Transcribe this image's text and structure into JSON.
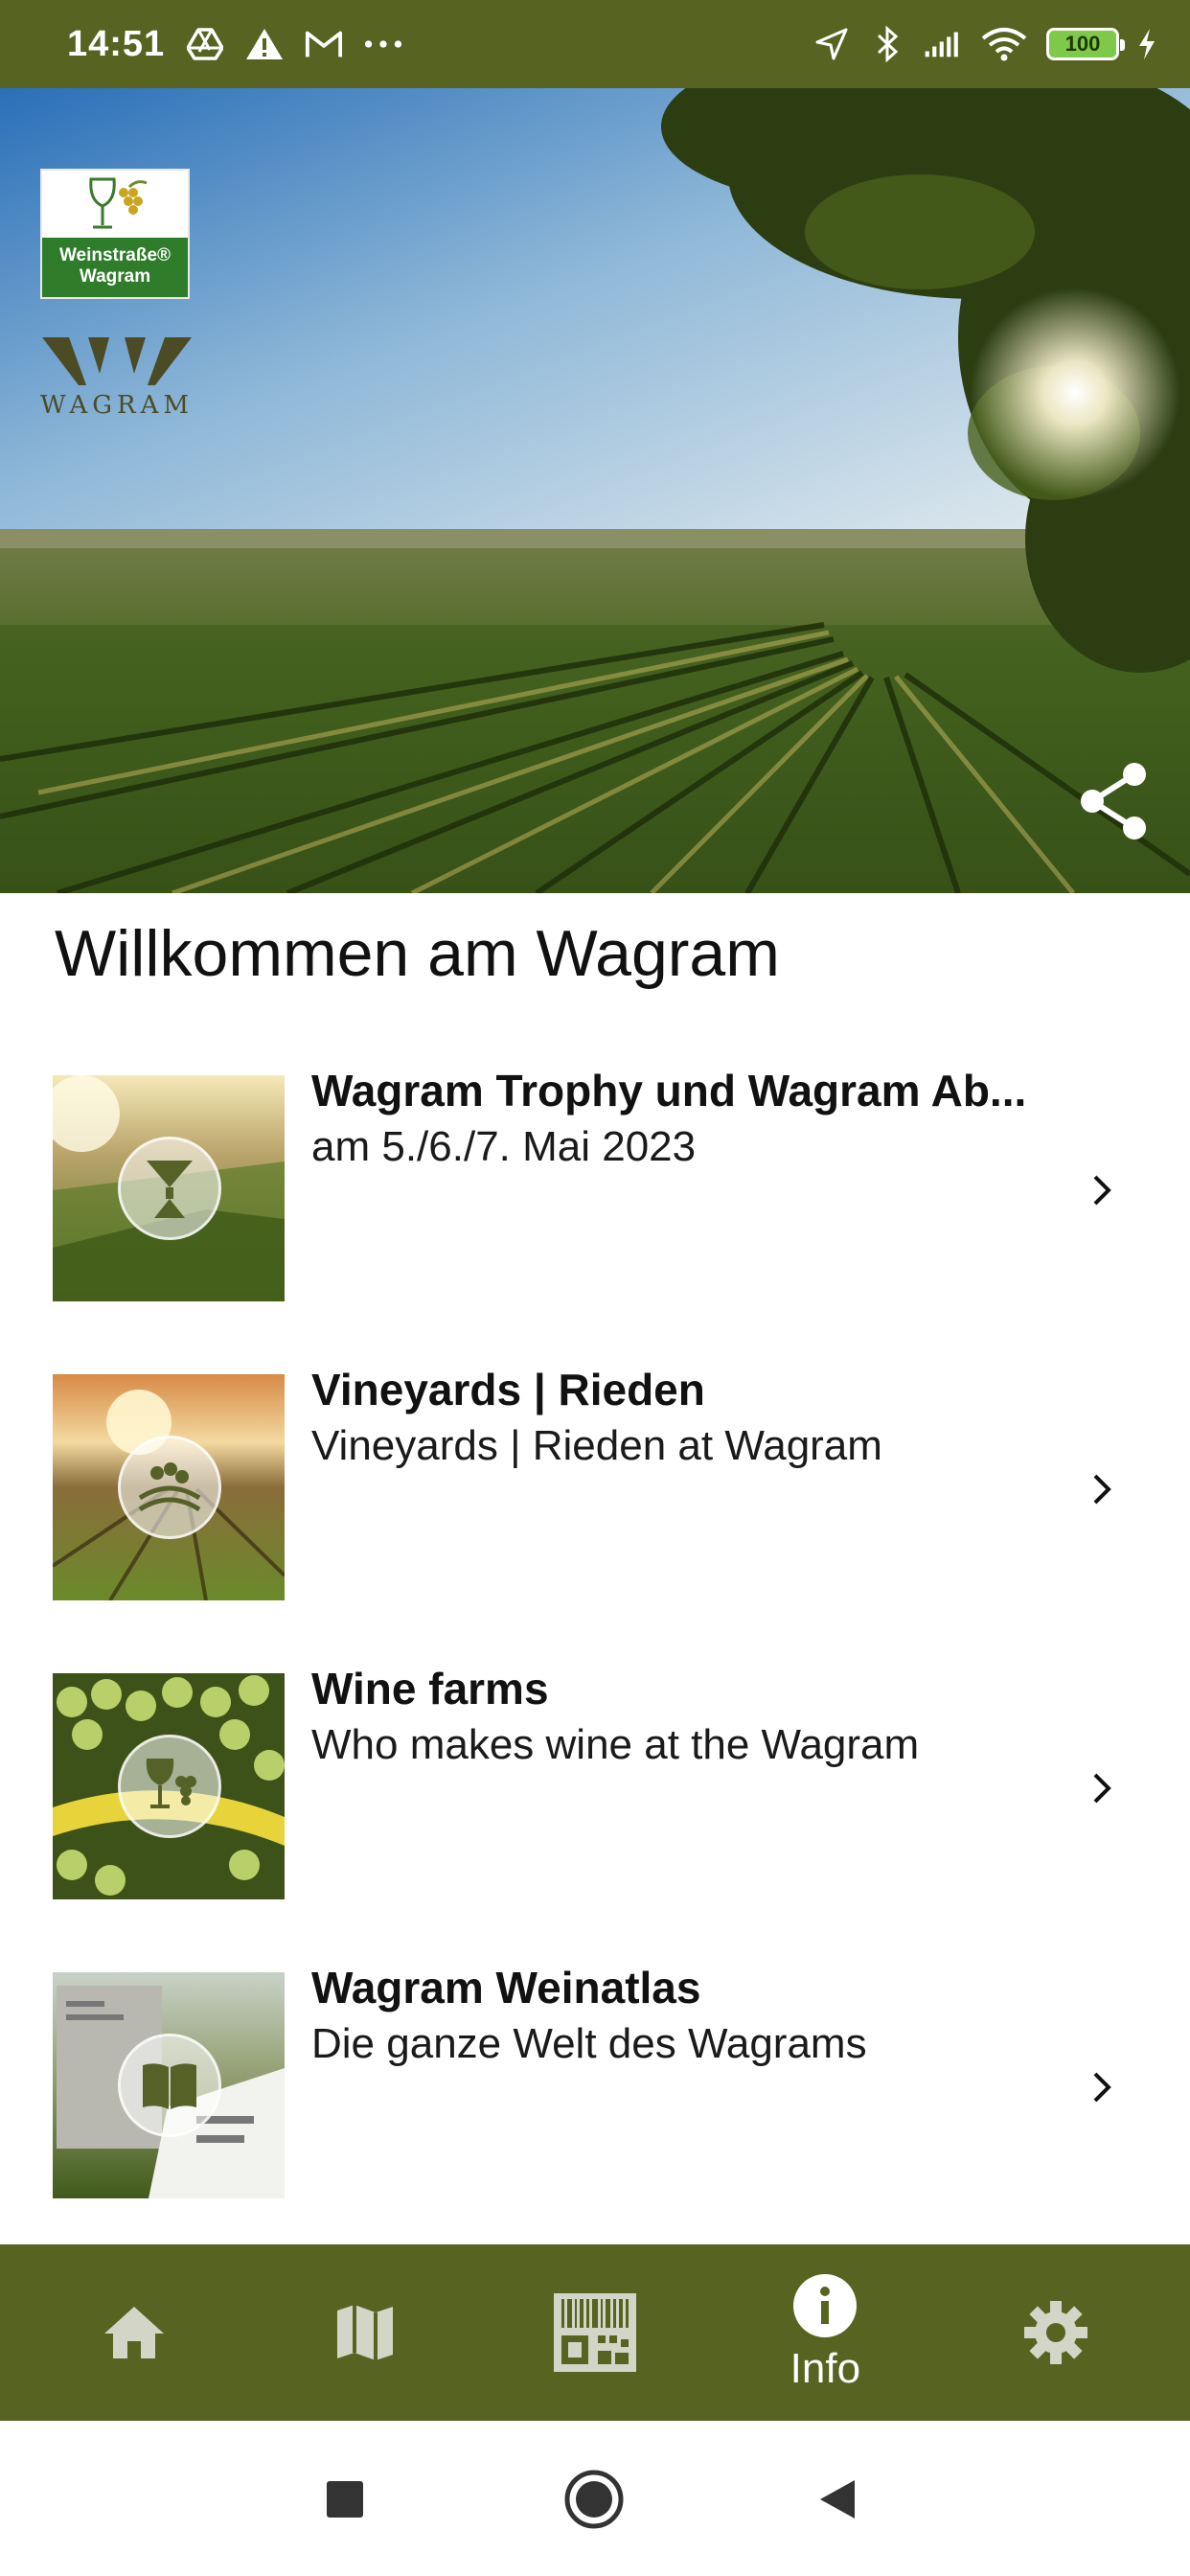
{
  "status_bar": {
    "time": "14:51",
    "battery": "100",
    "left_icons": [
      "drive-icon",
      "warning-icon",
      "gmail-icon",
      "more-dots-icon"
    ],
    "right_icons": [
      "location-icon",
      "bluetooth-icon",
      "signal-icon",
      "wifi-icon",
      "battery-icon",
      "charging-icon"
    ]
  },
  "hero": {
    "logo_line1": "Weinstraße®",
    "logo_line2": "Wagram",
    "brand_mark": "WAGRAM"
  },
  "page": {
    "title": "Willkommen am Wagram"
  },
  "items": [
    {
      "title": "Wagram Trophy und Wagram Ab...",
      "subtitle": "am 5./6./7. Mai 2023",
      "icon": "trophy-icon"
    },
    {
      "title": "Vineyards | Rieden",
      "subtitle": "Vineyards | Rieden at Wagram",
      "icon": "vineyard-icon"
    },
    {
      "title": "Wine farms",
      "subtitle": "Who makes wine at the Wagram",
      "icon": "wine-glass-grapes-icon"
    },
    {
      "title": "Wagram Weinatlas",
      "subtitle": "Die ganze Welt des Wagrams",
      "icon": "book-icon"
    }
  ],
  "bottom_nav": {
    "items": [
      "home-icon",
      "map-icon",
      "qr-code-icon",
      "info-icon",
      "settings-icon"
    ],
    "active_label": "Info"
  },
  "colors": {
    "brand_green": "#566321",
    "logo_green": "#2f7d2b"
  }
}
